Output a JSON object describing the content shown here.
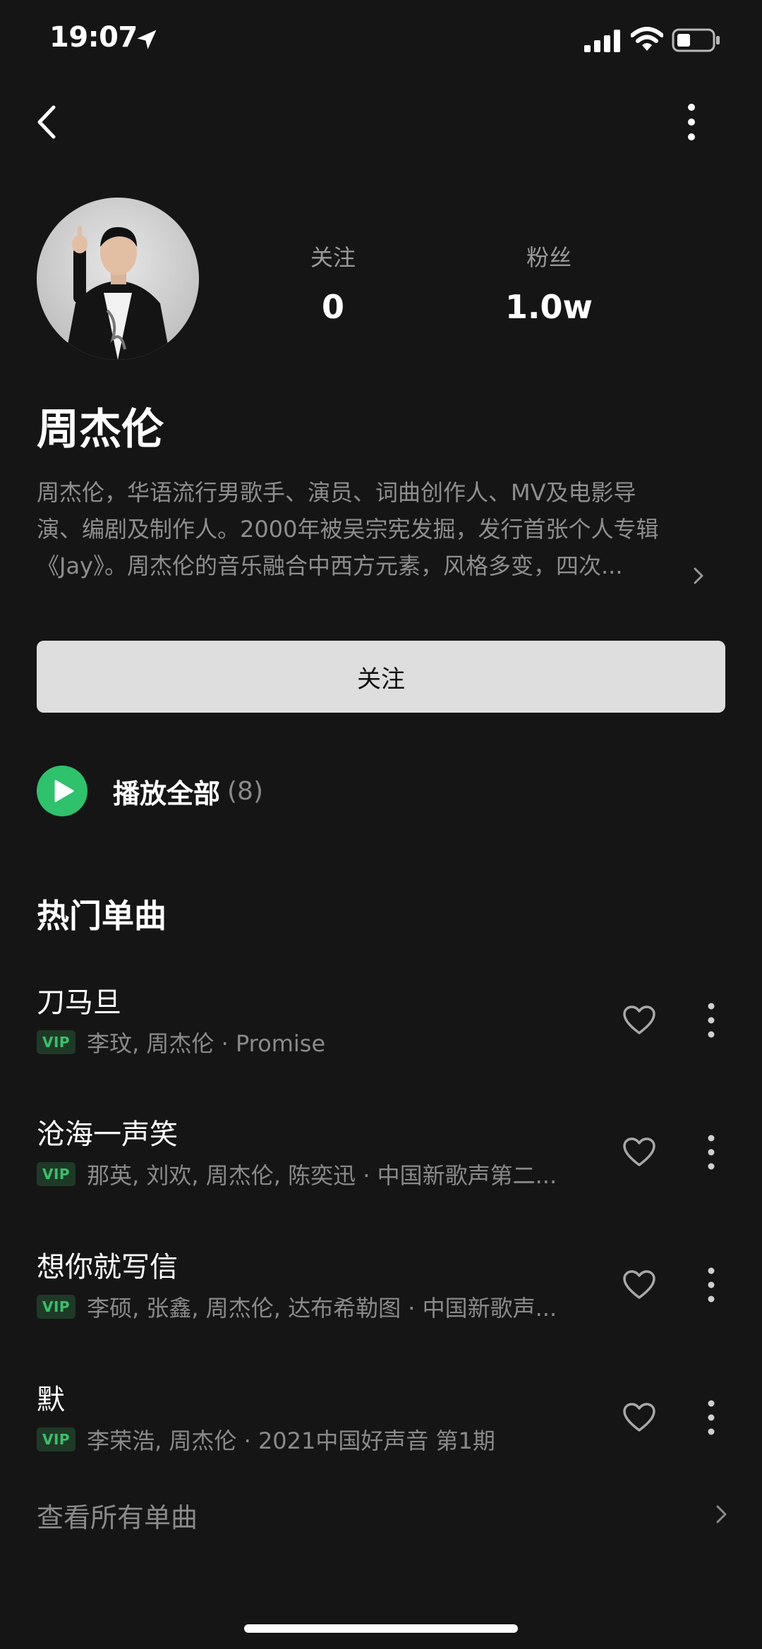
{
  "status_bar": {
    "time": "19:07"
  },
  "profile": {
    "stats": [
      {
        "label": "关注",
        "value": "0"
      },
      {
        "label": "粉丝",
        "value": "1.0w"
      }
    ],
    "name": "周杰伦",
    "bio_lines": [
      "周杰伦，华语流行男歌手、演员、词曲创作人、MV及电影导",
      "演、编剧及制作人。2000年被吴宗宪发掘，发行首张个人专辑",
      "《Jay》。周杰伦的音乐融合中西方元素，风格多变，四次..."
    ],
    "follow_label": "关注"
  },
  "play_all": {
    "label": "播放全部",
    "count": "(8)"
  },
  "hot_singles": {
    "title": "热门单曲",
    "songs": [
      {
        "title": "刀马旦",
        "badge": "VIP",
        "meta": "李玟, 周杰伦 · Promise"
      },
      {
        "title": "沧海一声笑",
        "badge": "VIP",
        "meta": "那英, 刘欢, 周杰伦, 陈奕迅 · 中国新歌声第二..."
      },
      {
        "title": "想你就写信",
        "badge": "VIP",
        "meta": "李硕, 张鑫, 周杰伦, 达布希勒图 · 中国新歌声..."
      },
      {
        "title": "默",
        "badge": "VIP",
        "meta": "李荣浩, 周杰伦 · 2021中国好声音 第1期"
      }
    ],
    "view_all_label": "查看所有单曲"
  },
  "colors": {
    "background": "#151515",
    "accent_green": "#2dc26b",
    "follow_button_bg": "#dedede",
    "vip_badge_text": "#3cc06a"
  }
}
